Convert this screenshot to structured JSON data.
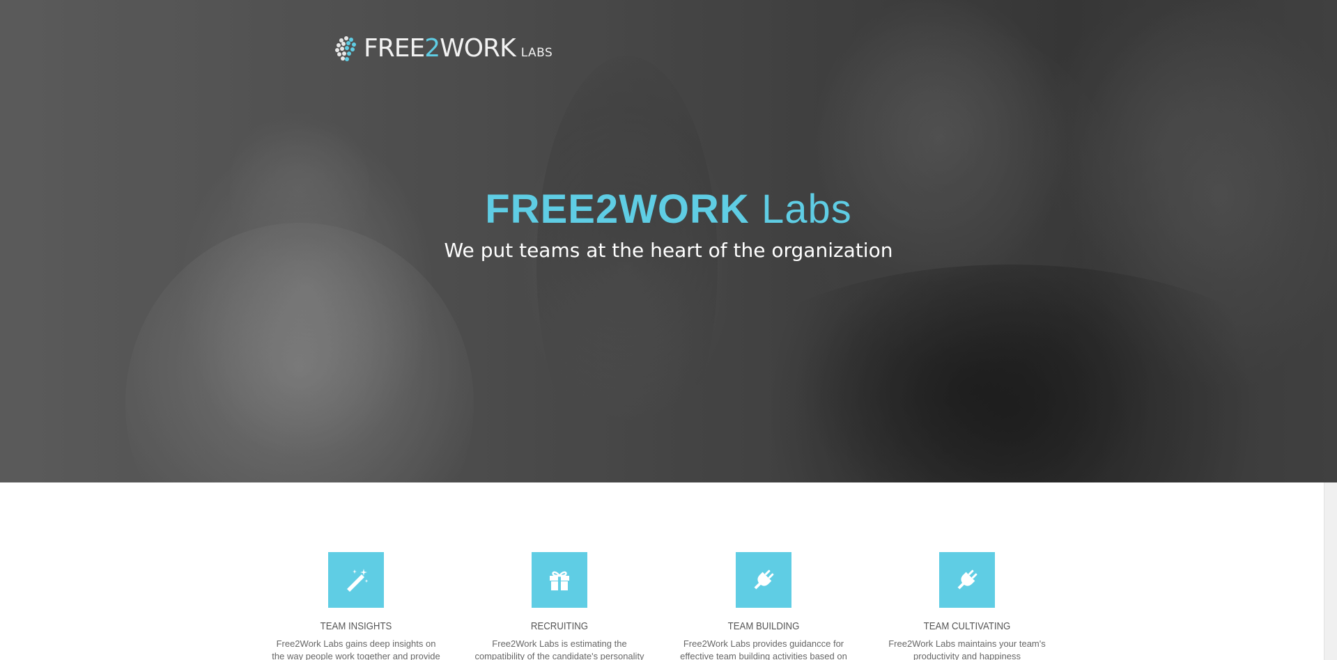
{
  "brand": {
    "logo_main": "FREE",
    "logo_accent": "2",
    "logo_rest": "WORK",
    "logo_sub": "LABS",
    "accent_color": "#5fcde4"
  },
  "hero": {
    "title_bold": "FREE2WORK",
    "title_light": "Labs",
    "subtitle": "We put teams at the heart of the organization"
  },
  "services": [
    {
      "icon": "magic-wand-icon",
      "title": "TEAM INSIGHTS",
      "text": "Free2Work Labs gains deep insights on the way people work together and provide"
    },
    {
      "icon": "gift-icon",
      "title": "RECRUITING",
      "text": "Free2Work Labs is estimating the compatibility of the candidate's personality"
    },
    {
      "icon": "plug-icon",
      "title": "TEAM BUILDING",
      "text": "Free2Work Labs provides guidancce for effective team building activities based on"
    },
    {
      "icon": "plug-icon",
      "title": "TEAM CULTIVATING",
      "text": "Free2Work Labs maintains your team's productivity and happiness"
    }
  ]
}
